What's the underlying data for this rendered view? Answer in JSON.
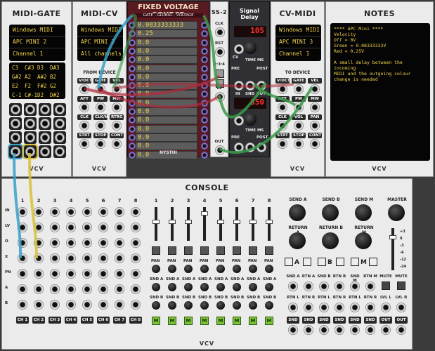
{
  "midi_gate": {
    "title": "MIDI-GATE",
    "device_rows": [
      "Windows MIDI",
      "APC MINI 2",
      "Channel 1"
    ],
    "notes": [
      "C3",
      "C#3",
      "D3",
      "D#3",
      "G#2",
      "A2",
      "A#2",
      "B2",
      "E2",
      "F2",
      "F#2",
      "G2",
      "C-1",
      "C#-1",
      "D2",
      "D#2"
    ],
    "brand": "VCV"
  },
  "midi_cv": {
    "title": "MIDI-CV",
    "device_rows": [
      "Windows MIDI",
      "APC MINI 2",
      "All channels"
    ],
    "from_device": "FROM DEVICE",
    "labels": [
      "V/OCT",
      "GATE",
      "VEL",
      "AFT",
      "PW",
      "MW",
      "CLK",
      "CLK/N",
      "RTRG",
      "STRT",
      "STOP",
      "CONT"
    ],
    "brand": "VCV"
  },
  "fvs": {
    "title": "FIXED VOLTAGE SOURCE",
    "subtitle": "GATE - GLOBAL - VOLTAGE",
    "values": [
      "0.0833333333",
      "0.25",
      "0.0",
      "0.0",
      "0.0",
      "0.0",
      "0.0",
      "0.0",
      "0.0",
      "0.0",
      "0.0",
      "0.0",
      "0.0",
      "0.0",
      "0.0",
      "0.0"
    ],
    "brand": "NYSTHI"
  },
  "ss2": {
    "title": "SS-2",
    "labels": [
      "CLK",
      "RST",
      "2:3:4",
      "IN",
      "OUT"
    ]
  },
  "signal_delay": {
    "title": "Signal Delay",
    "displays": [
      "105",
      "350"
    ],
    "labels": [
      "CV",
      "TIME MS",
      "PRE",
      "POST",
      "IN",
      "SND",
      "OUT"
    ]
  },
  "cv_midi": {
    "title": "CV-MIDI",
    "device_rows": [
      "Windows MIDI",
      "APC MINI 3",
      "Channel 1"
    ],
    "to_device": "TO DEVICE",
    "labels": [
      "V/OCT",
      "GATE",
      "VEL",
      "AFT",
      "PW",
      "MW",
      "CLK",
      "VOL",
      "PAN",
      "STRT",
      "STOP",
      "CONT"
    ],
    "brand": "VCV"
  },
  "notes_mod": {
    "title": "NOTES",
    "text_lines": [
      "**** APC Mini ****",
      "Velocity",
      "Off = 0V",
      "Green = 0.08333333V",
      "Red = 0.25V",
      "",
      "A small delay between the incoming",
      "MIDI and the outgoing colour",
      "change is needed"
    ],
    "brand": "VCV"
  },
  "console": {
    "title": "CONSOLE",
    "channels": [
      "1",
      "2",
      "3",
      "4",
      "5",
      "6",
      "7",
      "8"
    ],
    "row_labels": [
      "IN",
      "LV",
      "O",
      "X",
      "PN",
      "A",
      "B"
    ],
    "ch_labels": [
      "CH 1",
      "CH 2",
      "CH 3",
      "CH 4",
      "CH 5",
      "CH 6",
      "CH 7",
      "CH 8"
    ],
    "mixer_labels": [
      "PAN",
      "SND A",
      "SND B",
      "M"
    ],
    "sends": [
      "SEND A",
      "SEND B",
      "SEND M",
      "MASTER"
    ],
    "returns": [
      "RETURN A",
      "RETURN B",
      "RETURN M"
    ],
    "return_letters": [
      "A",
      "B",
      "M"
    ],
    "meter": [
      "+3",
      "0",
      "-3",
      "-6",
      "-12",
      "-24"
    ],
    "bottom_labels": [
      "SND A",
      "RTN A",
      "SND B",
      "RTN B",
      "SND M",
      "RTN M",
      "MUTE",
      "MUTE"
    ],
    "io_labels": [
      "RTN L",
      "RTN R",
      "RTN L",
      "RTN R",
      "RTN L",
      "RTN R",
      "LVL L",
      "LVL R"
    ],
    "out_labels": [
      "SND L",
      "SND R",
      "SND L",
      "SND R",
      "SND L",
      "SND R",
      "OUT L",
      "OUT R"
    ],
    "brand": "VCV"
  },
  "colors": {
    "cable_blue": "#3aa0c8",
    "cable_green": "#3a9a4a",
    "cable_yellow": "#d8c23a",
    "cable_red": "#b02a3a",
    "screen_text": "#f4d44a"
  }
}
